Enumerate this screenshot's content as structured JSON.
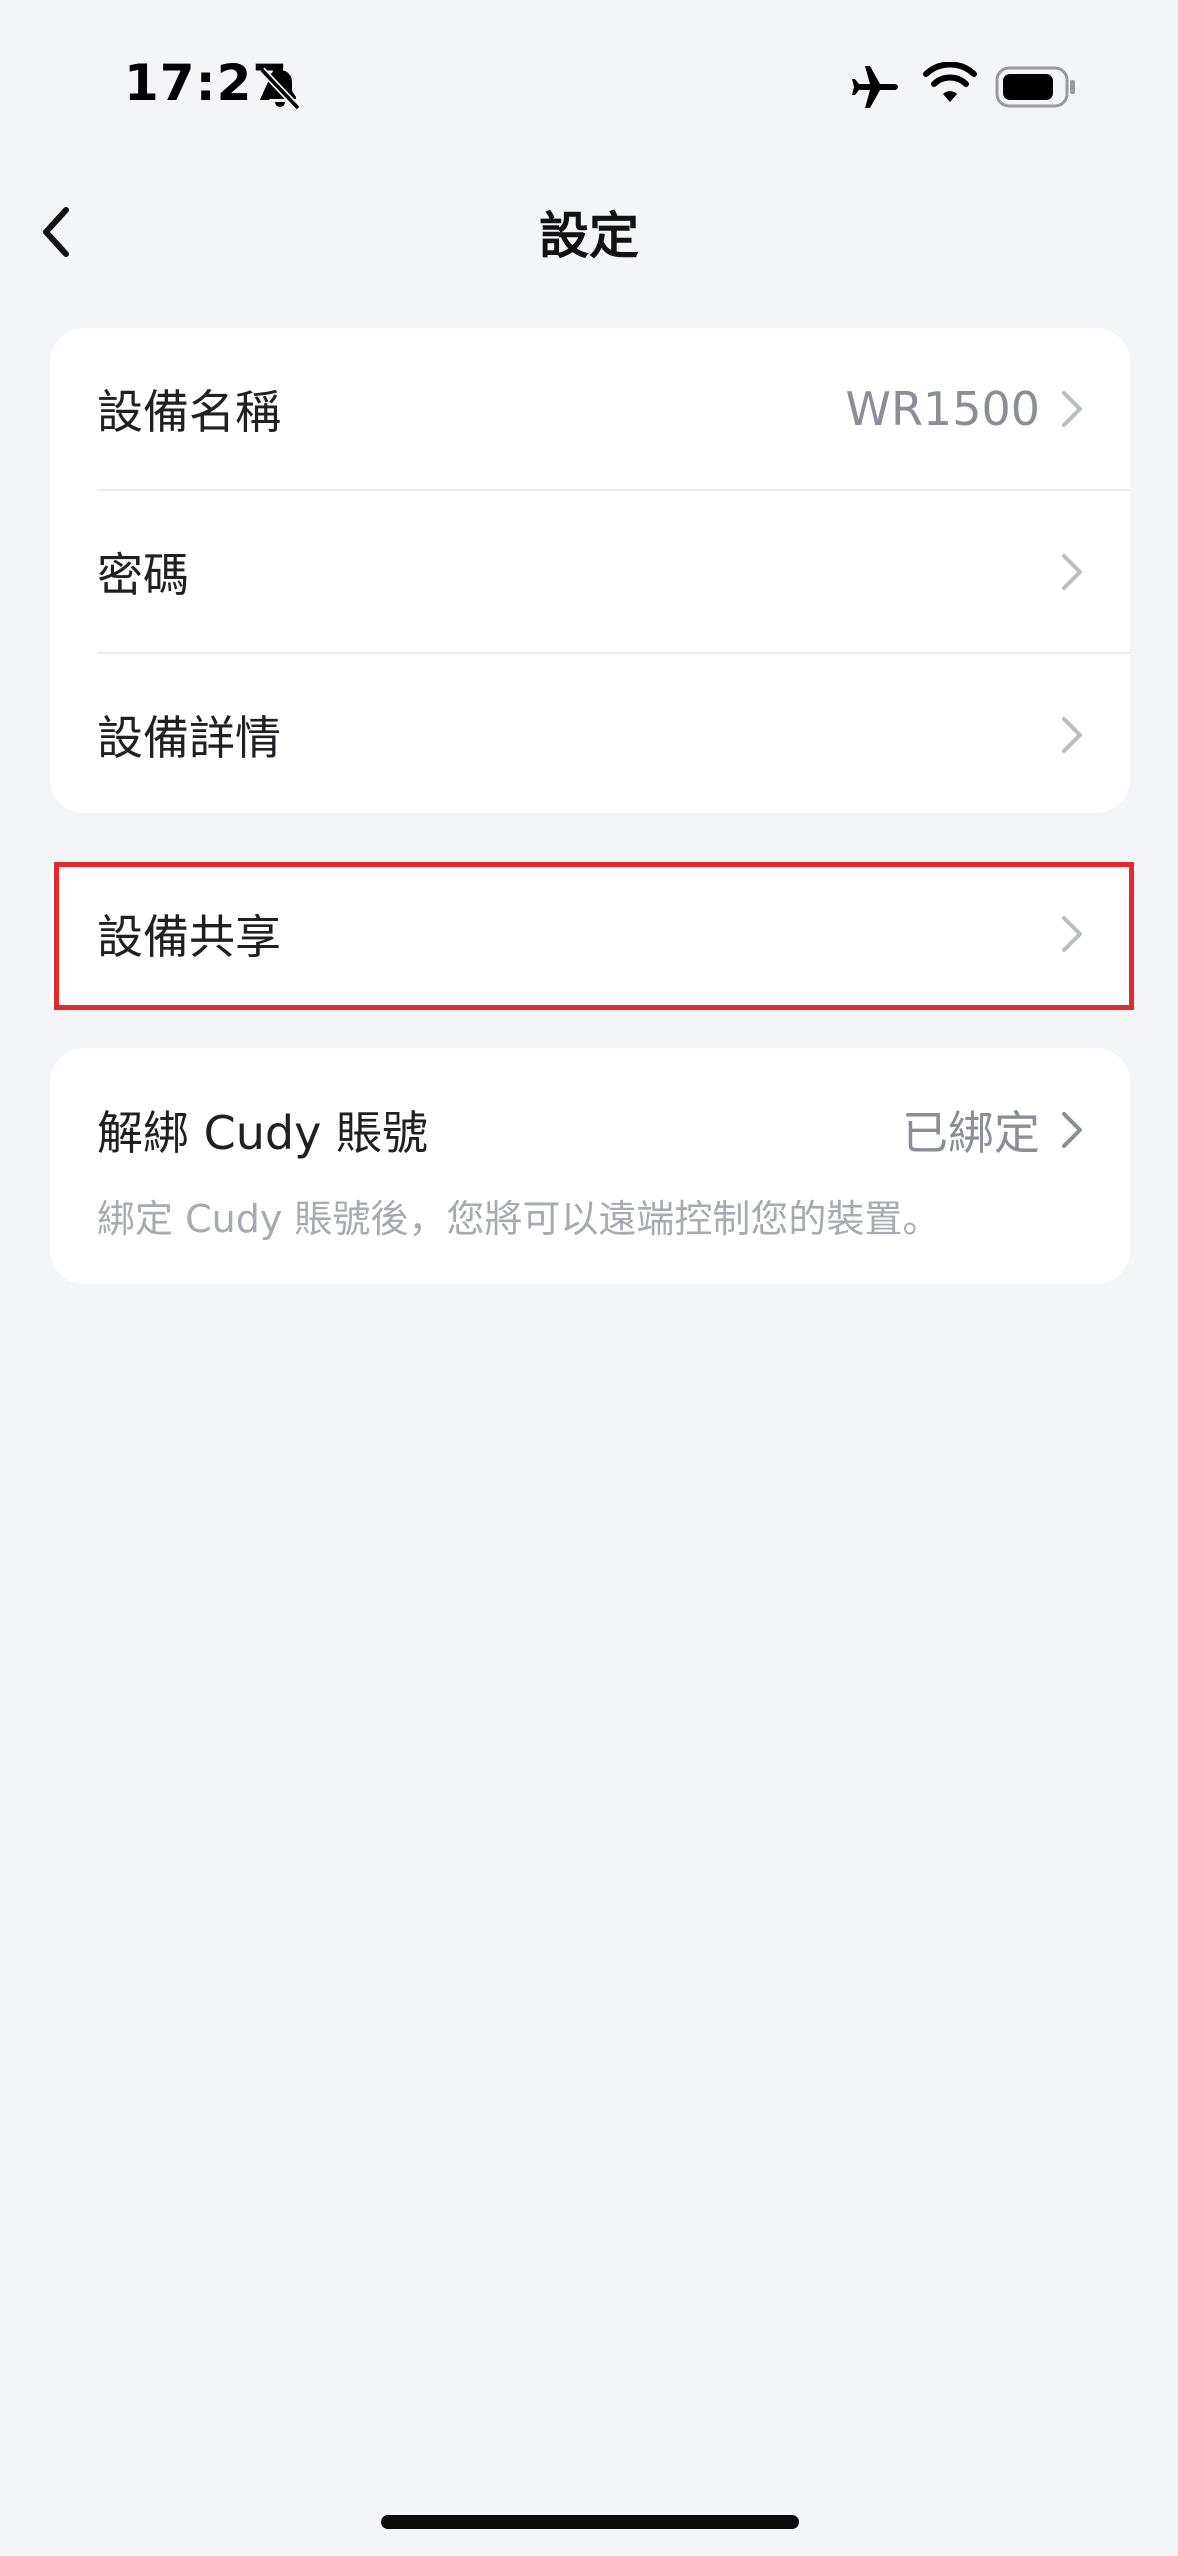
{
  "status_bar": {
    "time": "17:27",
    "icons": [
      "mute-bell-icon",
      "airplane-icon",
      "wifi-icon",
      "battery-icon"
    ]
  },
  "header": {
    "title": "設定",
    "back_icon": "chevron-left-icon"
  },
  "settings": {
    "group1": [
      {
        "label": "設備名稱",
        "value": "WR1500"
      },
      {
        "label": "密碼",
        "value": ""
      },
      {
        "label": "設備詳情",
        "value": ""
      }
    ],
    "share": {
      "label": "設備共享",
      "highlighted": true
    },
    "account": {
      "label": "解綁 Cudy 賬號",
      "value": "已綁定",
      "description": "綁定 Cudy 賬號後，您將可以遠端控制您的裝置。"
    }
  },
  "colors": {
    "background": "#f3f5f9",
    "card": "#ffffff",
    "highlight": "#e02a2f",
    "secondary_text": "#8b8e96"
  }
}
